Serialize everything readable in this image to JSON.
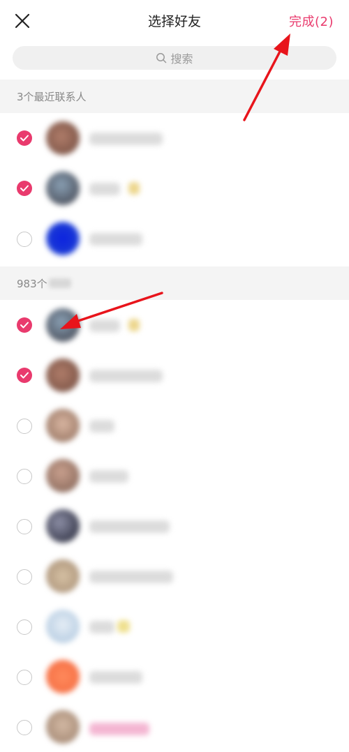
{
  "header": {
    "title": "选择好友",
    "done_label": "完成(2)"
  },
  "search": {
    "placeholder": "搜索"
  },
  "sections": {
    "recent_label": "3个最近联系人",
    "all_label": "983个"
  },
  "colors": {
    "accent": "#e93a6d",
    "annotation_arrow": "#e8141b"
  },
  "icons": {
    "close": "close-icon",
    "search": "search-icon",
    "check": "check-icon"
  },
  "contacts": [
    {
      "checked": true,
      "section": "recent"
    },
    {
      "checked": true,
      "section": "recent"
    },
    {
      "checked": false,
      "section": "recent"
    },
    {
      "checked": true,
      "section": "all"
    },
    {
      "checked": true,
      "section": "all"
    },
    {
      "checked": false,
      "section": "all"
    },
    {
      "checked": false,
      "section": "all"
    },
    {
      "checked": false,
      "section": "all"
    },
    {
      "checked": false,
      "section": "all"
    },
    {
      "checked": false,
      "section": "all"
    },
    {
      "checked": false,
      "section": "all"
    },
    {
      "checked": false,
      "section": "all"
    }
  ]
}
